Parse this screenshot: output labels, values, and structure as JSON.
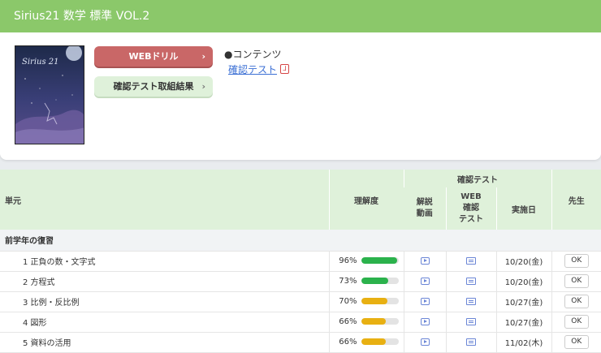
{
  "header": {
    "title": "Sirius21 数学 標準 VOL.2"
  },
  "book": {
    "cover_title": "Sirius 21",
    "cover_icon": "book-cover-image"
  },
  "buttons": {
    "web_drill": "WEBドリル",
    "test_results": "確認テスト取組結果",
    "chevron": "›"
  },
  "contents": {
    "heading": "●コンテンツ",
    "link": "確認テスト",
    "pdf_icon": "pdf-icon",
    "pdf_glyph": "⅃"
  },
  "table": {
    "group_header": "確認テスト",
    "headers": {
      "unit": "単元",
      "understanding": "理解度",
      "video": "解説\n動画",
      "webtest": "WEB\n確認\nテスト",
      "date": "実施日",
      "teacher": "先生"
    },
    "section": "前学年の復習",
    "rows": [
      {
        "unit": "1 正負の数・文字式",
        "pct": "96%",
        "level": 0.96,
        "color": "#2bb24c",
        "date": "10/20(金)",
        "ok": "OK"
      },
      {
        "unit": "2 方程式",
        "pct": "73%",
        "level": 0.73,
        "color": "#2bb24c",
        "date": "10/20(金)",
        "ok": "OK"
      },
      {
        "unit": "3 比例・反比例",
        "pct": "70%",
        "level": 0.7,
        "color": "#e8b012",
        "date": "10/27(金)",
        "ok": "OK"
      },
      {
        "unit": "4 図形",
        "pct": "66%",
        "level": 0.66,
        "color": "#e8b012",
        "date": "10/27(金)",
        "ok": "OK"
      },
      {
        "unit": "5 資料の活用",
        "pct": "66%",
        "level": 0.66,
        "color": "#e8b012",
        "date": "11/02(木)",
        "ok": "OK"
      }
    ]
  }
}
